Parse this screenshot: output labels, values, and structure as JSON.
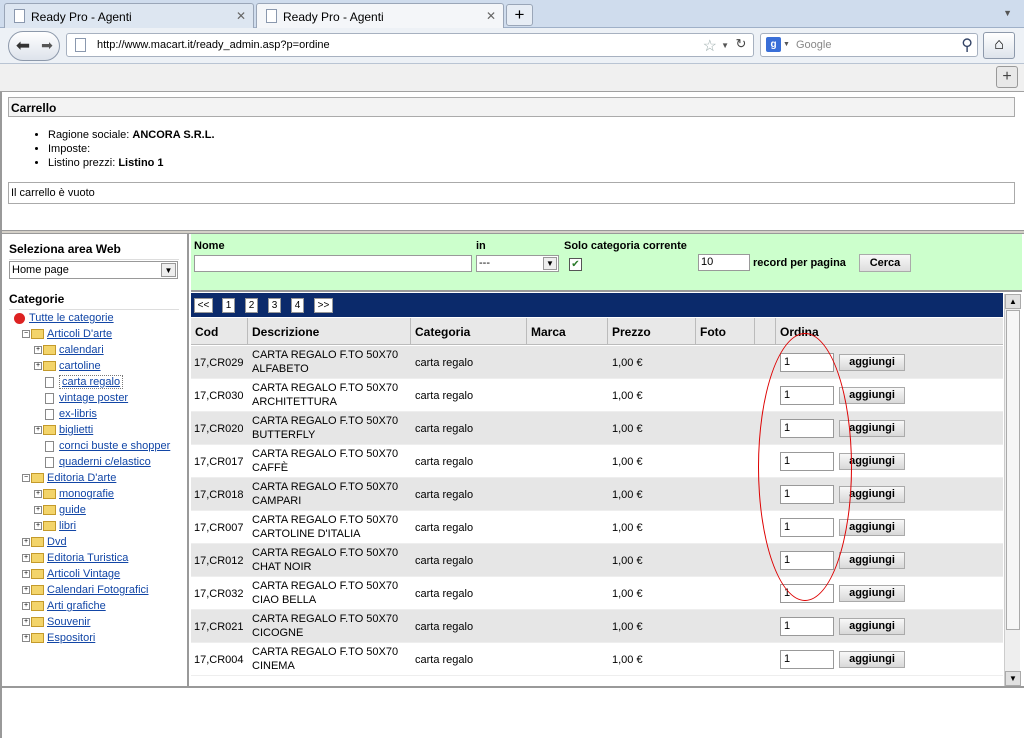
{
  "browser": {
    "tabs": [
      {
        "title": "Ready Pro - Agenti",
        "active": false
      },
      {
        "title": "Ready Pro - Agenti",
        "active": true
      }
    ],
    "new_tab": "+",
    "url": "http://www.macart.it/ready_admin.asp?p=ordine",
    "search_placeholder": "Google"
  },
  "cart": {
    "title": "Carrello",
    "info": [
      {
        "label": "Ragione sociale:",
        "value": "ANCORA S.R.L."
      },
      {
        "label": "Imposte:",
        "value": ""
      },
      {
        "label": "Listino prezzi:",
        "value": "Listino 1"
      }
    ],
    "empty_message": "Il carrello è vuoto"
  },
  "sidebar": {
    "area_title": "Seleziona area Web",
    "area_selected": "Home page",
    "categories_title": "Categorie",
    "tree": [
      {
        "label": "Tutte le categorie",
        "level": 0,
        "icon": "strawberry-icon"
      },
      {
        "label": "Articoli D'arte",
        "level": 1,
        "icon": "folder-icon",
        "toggle": "⊟"
      },
      {
        "label": "calendari",
        "level": 2,
        "icon": "folder-icon",
        "toggle": "⊞"
      },
      {
        "label": "cartoline",
        "level": 2,
        "icon": "folder-icon",
        "toggle": "⊞"
      },
      {
        "label": "carta regalo",
        "level": 2,
        "icon": "document-icon",
        "selected": true
      },
      {
        "label": "vintage poster",
        "level": 2,
        "icon": "document-icon"
      },
      {
        "label": "ex-libris",
        "level": 2,
        "icon": "document-icon"
      },
      {
        "label": "biglietti",
        "level": 2,
        "icon": "folder-icon",
        "toggle": "⊞"
      },
      {
        "label": "cornci buste e shopper",
        "level": 2,
        "icon": "document-icon"
      },
      {
        "label": "quaderni c/elastico",
        "level": 2,
        "icon": "document-icon"
      },
      {
        "label": "Editoria D'arte",
        "level": 1,
        "icon": "folder-icon",
        "toggle": "⊟"
      },
      {
        "label": "monografie",
        "level": 2,
        "icon": "folder-icon",
        "toggle": "⊞"
      },
      {
        "label": "guide",
        "level": 2,
        "icon": "folder-icon",
        "toggle": "⊞"
      },
      {
        "label": "libri",
        "level": 2,
        "icon": "folder-icon",
        "toggle": "⊞"
      },
      {
        "label": "Dvd",
        "level": 1,
        "icon": "folder-icon",
        "toggle": "⊞"
      },
      {
        "label": "Editoria Turistica",
        "level": 1,
        "icon": "folder-icon",
        "toggle": "⊞"
      },
      {
        "label": "Articoli Vintage",
        "level": 1,
        "icon": "folder-icon",
        "toggle": "⊞"
      },
      {
        "label": "Calendari Fotografici",
        "level": 1,
        "icon": "folder-icon",
        "toggle": "⊞"
      },
      {
        "label": "Arti grafiche",
        "level": 1,
        "icon": "folder-icon",
        "toggle": "⊞"
      },
      {
        "label": "Souvenir",
        "level": 1,
        "icon": "folder-icon",
        "toggle": "⊞"
      },
      {
        "label": "Espositori",
        "level": 1,
        "icon": "folder-icon",
        "toggle": "⊞"
      }
    ]
  },
  "filter": {
    "name_label": "Nome",
    "name_value": "",
    "in_label": "in",
    "in_value": "---",
    "solo_label": "Solo categoria corrente",
    "solo_checked": true,
    "records_value": "10",
    "records_label": "record per pagina",
    "search_button": "Cerca"
  },
  "pager": [
    "<<",
    "1",
    "2",
    "3",
    "4",
    ">>"
  ],
  "table": {
    "columns": [
      "Cod",
      "Descrizione",
      "Categoria",
      "Marca",
      "Prezzo",
      "Foto",
      "",
      "Ordina"
    ],
    "add_label": "aggiungi",
    "rows": [
      {
        "cod": "17,CR029",
        "desc1": "CARTA REGALO F.TO 50X70",
        "desc2": "ALFABETO",
        "cat": "carta regalo",
        "price": "1,00 €",
        "qty": "1"
      },
      {
        "cod": "17,CR030",
        "desc1": "CARTA REGALO F.TO 50X70",
        "desc2": "ARCHITETTURA",
        "cat": "carta regalo",
        "price": "1,00 €",
        "qty": "1"
      },
      {
        "cod": "17,CR020",
        "desc1": "CARTA REGALO F.TO 50X70",
        "desc2": "BUTTERFLY",
        "cat": "carta regalo",
        "price": "1,00 €",
        "qty": "1"
      },
      {
        "cod": "17,CR017",
        "desc1": "CARTA REGALO F.TO 50X70",
        "desc2": "CAFFÈ",
        "cat": "carta regalo",
        "price": "1,00 €",
        "qty": "1"
      },
      {
        "cod": "17,CR018",
        "desc1": "CARTA REGALO F.TO 50X70",
        "desc2": "CAMPARI",
        "cat": "carta regalo",
        "price": "1,00 €",
        "qty": "1"
      },
      {
        "cod": "17,CR007",
        "desc1": "CARTA REGALO F.TO 50X70",
        "desc2": "CARTOLINE D'ITALIA",
        "cat": "carta regalo",
        "price": "1,00 €",
        "qty": "1"
      },
      {
        "cod": "17,CR012",
        "desc1": "CARTA REGALO F.TO 50X70",
        "desc2": "CHAT NOIR",
        "cat": "carta regalo",
        "price": "1,00 €",
        "qty": "1"
      },
      {
        "cod": "17,CR032",
        "desc1": "CARTA REGALO F.TO 50X70",
        "desc2": "CIAO BELLA",
        "cat": "carta regalo",
        "price": "1,00 €",
        "qty": "1"
      },
      {
        "cod": "17,CR021",
        "desc1": "CARTA REGALO F.TO 50X70",
        "desc2": "CICOGNE",
        "cat": "carta regalo",
        "price": "1,00 €",
        "qty": "1"
      },
      {
        "cod": "17,CR004",
        "desc1": "CARTA REGALO F.TO 50X70",
        "desc2": "CINEMA",
        "cat": "carta regalo",
        "price": "1,00 €",
        "qty": "1"
      }
    ]
  },
  "colors": {
    "filter_bg": "#ccffcc",
    "pager_bg": "#0b2a6b",
    "annotation": "#dd0000",
    "link": "#1246a6"
  }
}
